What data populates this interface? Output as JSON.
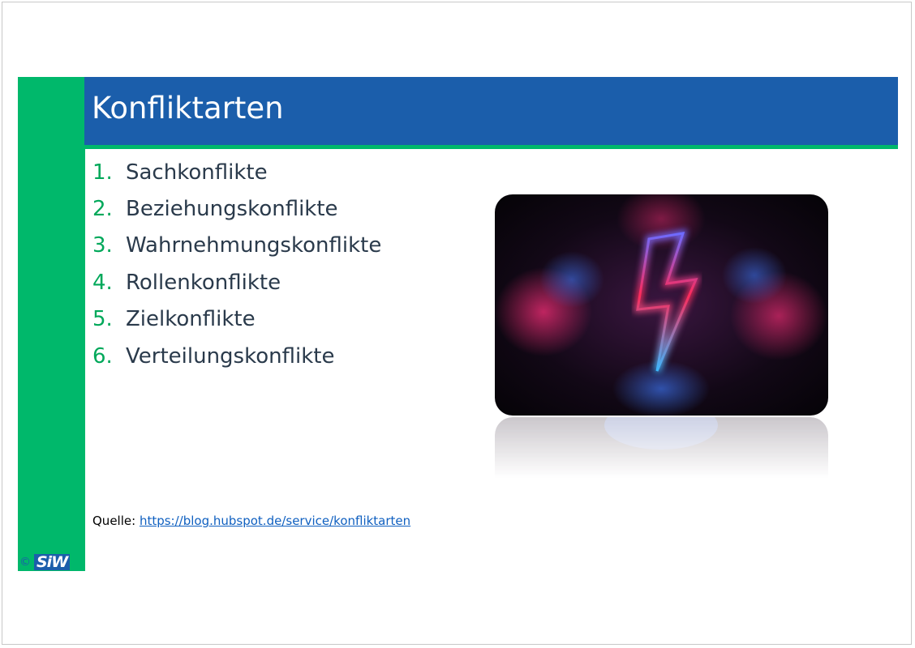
{
  "slide": {
    "title": "Konfliktarten",
    "items": [
      {
        "num": "1.",
        "label": "Sachkonflikte"
      },
      {
        "num": "2.",
        "label": "Beziehungskonflikte"
      },
      {
        "num": "3.",
        "label": "Wahrnehmungskonflikte"
      },
      {
        "num": "4.",
        "label": "Rollenkonflikte"
      },
      {
        "num": "5.",
        "label": "Zielkonflikte"
      },
      {
        "num": "6.",
        "label": "Verteilungskonflikte"
      }
    ],
    "source_label": "Quelle:",
    "source_link": "https://blog.hubspot.de/service/konfliktarten",
    "copyright": "©",
    "logo": "SiW"
  },
  "colors": {
    "accent_green": "#00b86b",
    "title_blue": "#1b5eab",
    "text_dark": "#2a3a4b",
    "number_green": "#00a85a"
  },
  "image": {
    "icon": "neon-lightning-bolt-icon"
  }
}
